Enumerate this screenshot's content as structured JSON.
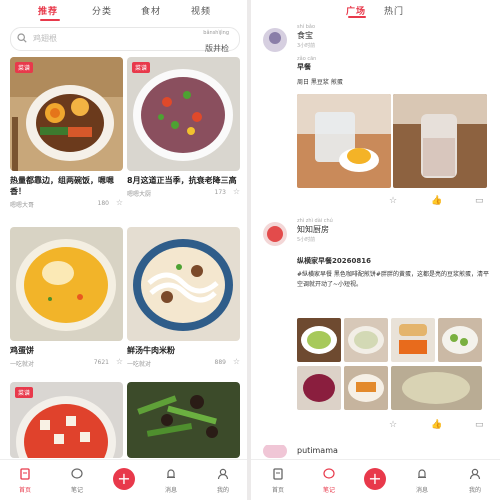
{
  "left": {
    "tabs": [
      "推荐",
      "分类",
      "食材",
      "视频"
    ],
    "search": {
      "placeholder": "鸡翅根",
      "hint_pinyin": "bǎnshìjìng",
      "hint_text": "版井检"
    },
    "cards": [
      {
        "badge": "菜谱",
        "title": "热量都靠边，组两碗饭，嗯嗯香！",
        "author": "嗯嗯大哥",
        "count": "180"
      },
      {
        "badge": "菜谱",
        "title": "8月这道正当季，抗衰老降三高",
        "author": "嗯嗯大厨",
        "count": "173"
      },
      {
        "badge": "",
        "title": "鸡蛋饼",
        "author": "一吃就对",
        "count": "7621"
      },
      {
        "badge": "",
        "title": "鲜汤牛肉米粉",
        "author": "一吃就对",
        "count": "889"
      },
      {
        "badge": "菜谱",
        "title": "",
        "author": "",
        "count": ""
      },
      {
        "badge": "",
        "title": "",
        "author": "",
        "count": ""
      }
    ],
    "nav": [
      "首页",
      "笔记",
      "",
      "消息",
      "我的"
    ]
  },
  "right": {
    "tabs": [
      "广场",
      "热门"
    ],
    "posts": [
      {
        "name_pinyin": "shí bǎo",
        "name": "食宝",
        "time": "3小时前",
        "text_pinyin": "zǎo cān",
        "text": "早餐",
        "tags": "周日 黑豆浆 煎蛋",
        "likes": "",
        "comments": ""
      },
      {
        "name_pinyin": "zhì zhì dài chú",
        "name": "知知厨房",
        "time": "5小时前",
        "text": "纵横家早餐20260816",
        "body": "#纵横家早餐 黑色咖啡配煎饼#胖胖的黄蛋，这都是亮的豆浆煎蛋，清平空调就开动了~小短视。",
        "likes": "",
        "comments": ""
      },
      {
        "name": "putimama",
        "time": "",
        "text": ""
      }
    ],
    "nav": [
      "首页",
      "笔记",
      "",
      "消息",
      "我的"
    ]
  },
  "colors": {
    "accent": "#e8394b"
  }
}
